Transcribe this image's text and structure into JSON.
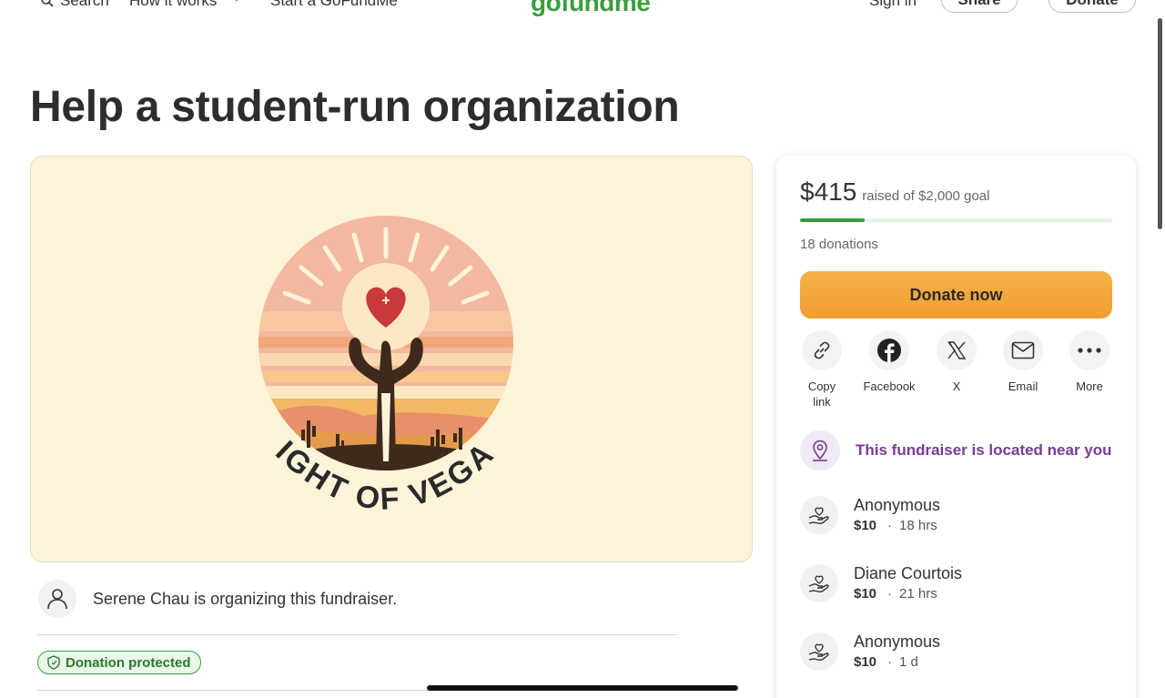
{
  "nav": {
    "search": "Search",
    "how_it_works": "How it works",
    "start": "Start a GoFundMe",
    "brand": "gofundme",
    "sign_in": "Sign in",
    "share": "Share",
    "donate": "Donate"
  },
  "page": {
    "title": "Help a student-run organization"
  },
  "hero": {
    "logo_text": "LIGHT OF VEGAS"
  },
  "organizer": {
    "text": "Serene Chau is organizing this fundraiser."
  },
  "badge": {
    "protected": "Donation protected"
  },
  "sidebar": {
    "raised_amount": "$415",
    "raised_goal": "raised of $2,000 goal",
    "progress_fraction": 0.2075,
    "donation_count": "18 donations",
    "donate_now": "Donate now",
    "share_options": [
      {
        "label": "Copy link",
        "icon": "link-icon"
      },
      {
        "label": "Facebook",
        "icon": "facebook-icon"
      },
      {
        "label": "X",
        "icon": "x-icon"
      },
      {
        "label": "Email",
        "icon": "email-icon"
      },
      {
        "label": "More",
        "icon": "more-icon"
      }
    ],
    "near_you": "This fundraiser is located near you",
    "donations": [
      {
        "name": "Anonymous",
        "amount": "$10",
        "time": "18 hrs"
      },
      {
        "name": "Diane Courtois",
        "amount": "$10",
        "time": "21 hrs"
      },
      {
        "name": "Anonymous",
        "amount": "$10",
        "time": "1 d"
      }
    ]
  },
  "colors": {
    "brand_green": "#3a9d3a",
    "donate_orange": "#f5a93a",
    "near_purple": "#7a3b96",
    "hero_bg": "#fdf3d9"
  }
}
